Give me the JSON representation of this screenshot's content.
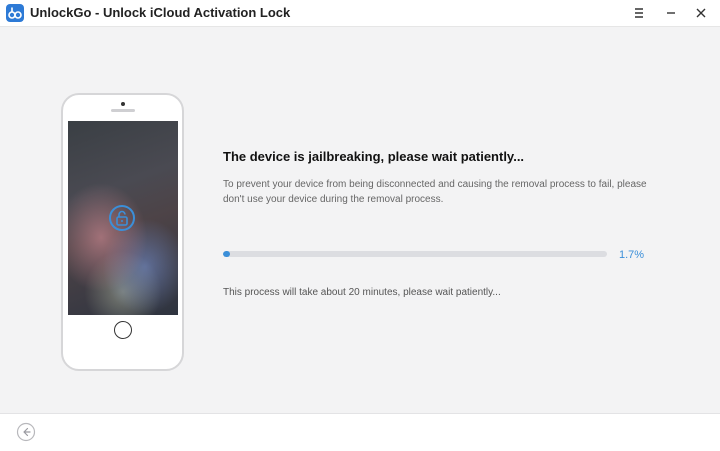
{
  "window": {
    "title": "UnlockGo - Unlock iCloud Activation Lock",
    "logo_icon": "unlockgo-logo-icon",
    "controls": [
      "menu-icon",
      "minimize-icon",
      "close-icon"
    ]
  },
  "main": {
    "headline": "The device is jailbreaking, please wait patiently...",
    "description": "To prevent your device from being disconnected and causing the removal process to fail, please don't use your device during the removal process.",
    "progress": {
      "value_percent": 1.7,
      "label": "1.7%"
    },
    "duration_note": "This process will take about 20 minutes, please wait patiently...",
    "phone_icon": "padlock-icon"
  },
  "footer": {
    "back_icon": "back-arrow-icon"
  },
  "colors": {
    "accent": "#3b8fd9",
    "logo": "#2d7ad6"
  }
}
